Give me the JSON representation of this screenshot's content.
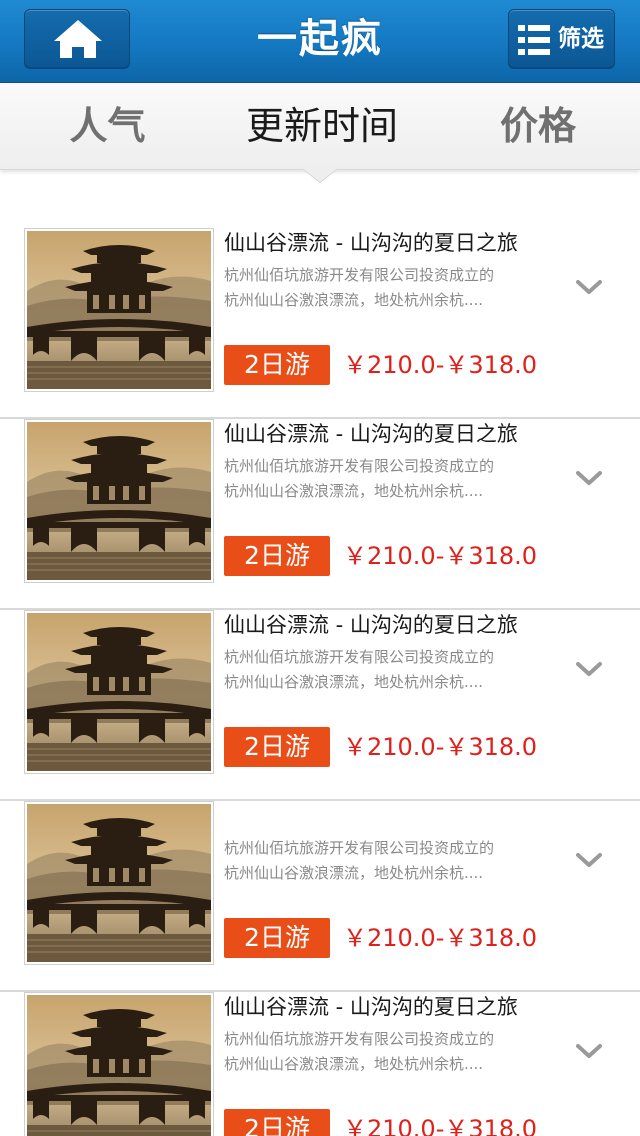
{
  "header": {
    "title": "一起疯",
    "filter_label": "筛选"
  },
  "tabs": [
    {
      "label": "人气",
      "active": false
    },
    {
      "label": "更新时间",
      "active": true
    },
    {
      "label": "价格",
      "active": false
    }
  ],
  "colors": {
    "header_blue": "#1478c1",
    "badge_orange": "#ea4e18",
    "price_red": "#e0201b"
  },
  "items": [
    {
      "title": "仙山谷漂流 - 山沟沟的夏日之旅",
      "desc_line1": "杭州仙佰坑旅游开发有限公司投资成立的",
      "desc_line2": "杭州仙山谷激浪漂流，地处杭州余杭....",
      "badge": "2日游",
      "price": "￥210.0-￥318.0"
    },
    {
      "title": "仙山谷漂流 - 山沟沟的夏日之旅",
      "desc_line1": "杭州仙佰坑旅游开发有限公司投资成立的",
      "desc_line2": "杭州仙山谷激浪漂流，地处杭州余杭....",
      "badge": "2日游",
      "price": "￥210.0-￥318.0"
    },
    {
      "title": "仙山谷漂流 - 山沟沟的夏日之旅",
      "desc_line1": "杭州仙佰坑旅游开发有限公司投资成立的",
      "desc_line2": "杭州仙山谷激浪漂流，地处杭州余杭....",
      "badge": "2日游",
      "price": "￥210.0-￥318.0"
    },
    {
      "title": "",
      "desc_line1": "杭州仙佰坑旅游开发有限公司投资成立的",
      "desc_line2": "杭州仙山谷激浪漂流，地处杭州余杭....",
      "badge": "2日游",
      "price": "￥210.0-￥318.0"
    },
    {
      "title": "仙山谷漂流 - 山沟沟的夏日之旅",
      "desc_line1": "杭州仙佰坑旅游开发有限公司投资成立的",
      "desc_line2": "杭州仙山谷激浪漂流，地处杭州余杭....",
      "badge": "2日游",
      "price": "￥210.0-￥318.0"
    }
  ]
}
